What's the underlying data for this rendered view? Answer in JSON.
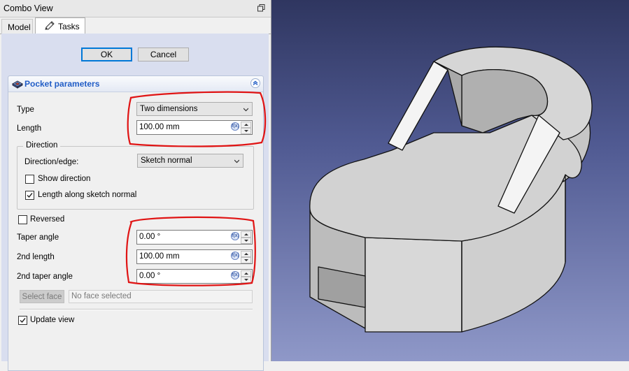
{
  "combo_view": {
    "title": "Combo View",
    "tabs": [
      {
        "label": "Model",
        "active": false
      },
      {
        "label": "Tasks",
        "active": true
      }
    ]
  },
  "dialog": {
    "ok_label": "OK",
    "cancel_label": "Cancel"
  },
  "pocket_parameters": {
    "title": "Pocket parameters",
    "type_label": "Type",
    "type_value": "Two dimensions",
    "length_label": "Length",
    "length_value": "100.00 mm",
    "direction_group": "Direction",
    "direction_edge_label": "Direction/edge:",
    "direction_edge_value": "Sketch normal",
    "show_direction_label": "Show direction",
    "show_direction_checked": false,
    "length_along_normal_label": "Length along sketch normal",
    "length_along_normal_checked": true,
    "reversed_label": "Reversed",
    "reversed_checked": false,
    "taper_angle_label": "Taper angle",
    "taper_angle_value": "0.00 °",
    "second_length_label": "2nd length",
    "second_length_value": "100.00 mm",
    "second_taper_label": "2nd taper angle",
    "second_taper_value": "0.00 °",
    "select_face_label": "Select face",
    "face_field_value": "No face selected",
    "update_view_label": "Update view",
    "update_view_checked": true
  },
  "colors": {
    "task_panel_bg": "#d9deef",
    "title_blue": "#215dc6",
    "annotation_red": "#e01414",
    "viewport_top": "#2f3660",
    "viewport_bottom": "#8f98c8",
    "model_face": "#d4d4d4"
  },
  "icons": {
    "float": "float-window-icon",
    "tasks_tab": "pencil-icon",
    "panel": "pocket-icon",
    "collapse": "collapse-chevron-icon",
    "formula": "formula-icon"
  }
}
